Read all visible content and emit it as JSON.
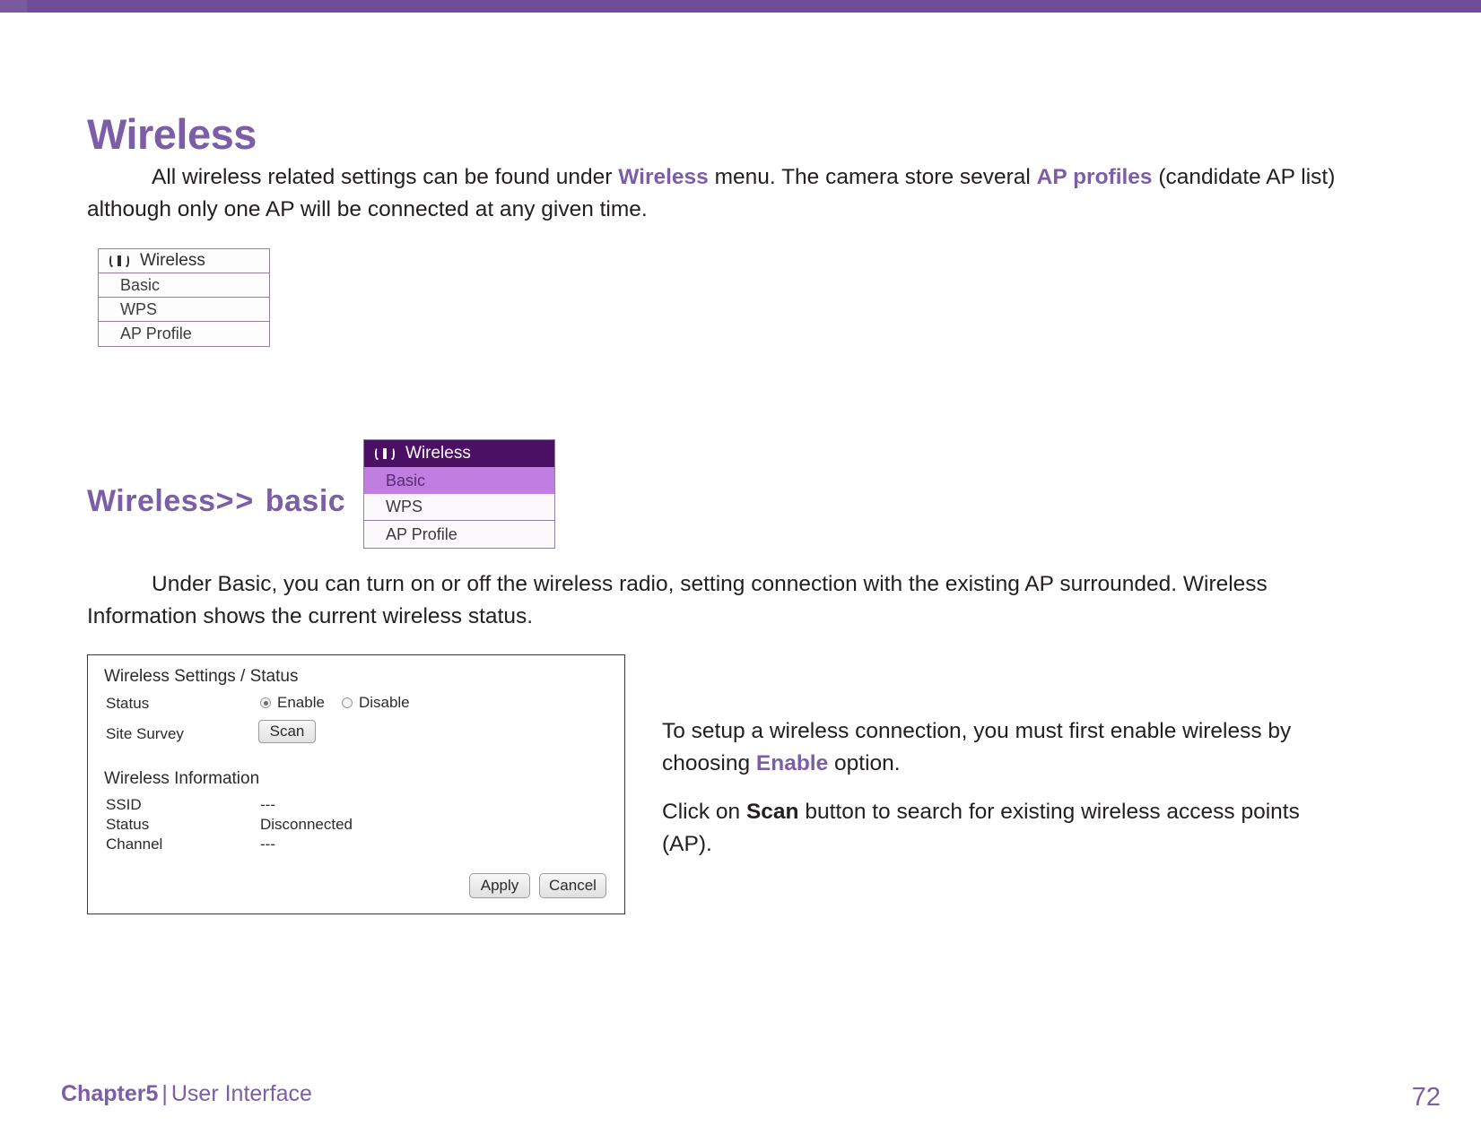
{
  "page": {
    "title": "Wireless",
    "accent_color": "#7b5ea7",
    "top_bar_color": "#6f4e97"
  },
  "intro": {
    "lead": "All wireless related settings can be found under ",
    "hl1": "Wireless",
    "mid": " menu. The camera store several ",
    "hl2": "AP profiles",
    "tail": " (candidate AP list) although only one AP will be connected at any given time."
  },
  "menu_plain": {
    "header": "Wireless",
    "icon": "wifi-icon",
    "items": [
      {
        "label": "Basic"
      },
      {
        "label": "WPS"
      },
      {
        "label": "AP Profile"
      }
    ]
  },
  "menu_highlight": {
    "header": "Wireless",
    "icon": "wifi-icon",
    "header_bg": "#4b0f63",
    "selected_bg": "#c07ee0",
    "items": [
      {
        "label": "Basic",
        "selected": true
      },
      {
        "label": "WPS",
        "selected": false
      },
      {
        "label": "AP Profile",
        "selected": false
      }
    ]
  },
  "section": {
    "heading_main": "Wireless",
    "heading_sep": ">> ",
    "heading_sub": "basic",
    "paragraph": "Under Basic, you can turn on or off the wireless radio, setting connection with the existing AP surrounded. Wireless Information shows the current wireless status."
  },
  "settings_panel": {
    "title": "Wireless Settings / Status",
    "status_label": "Status",
    "radio_enable": "Enable",
    "radio_disable": "Disable",
    "radio_selected": "Enable",
    "site_survey_label": "Site Survey",
    "scan_button": "Scan",
    "info_title": "Wireless Information",
    "rows": [
      {
        "label": "SSID",
        "value": "---"
      },
      {
        "label": "Status",
        "value": "Disconnected"
      },
      {
        "label": "Channel",
        "value": "---"
      }
    ],
    "apply_button": "Apply",
    "cancel_button": "Cancel"
  },
  "right_text": {
    "p1_a": "To setup a wireless connection, you must first enable wireless by choosing ",
    "p1_hl": "Enable",
    "p1_b": " option.",
    "p2_a": "Click on ",
    "p2_b": "Scan",
    "p2_c": " button to search for existing wireless access points (AP)."
  },
  "footer": {
    "chapter": "Chapter5",
    "divider": "|",
    "section": "User Interface",
    "page_number": "72"
  }
}
